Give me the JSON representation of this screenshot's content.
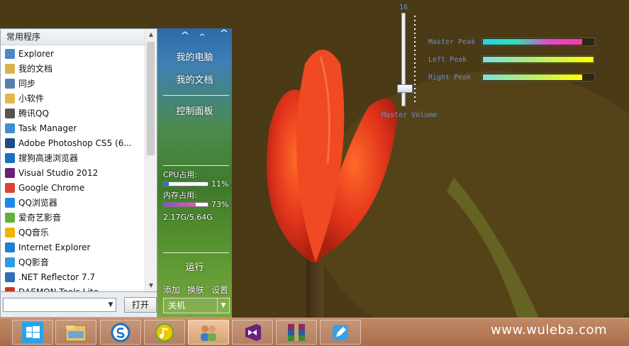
{
  "start_menu": {
    "list_header": "常用程序",
    "apps": [
      {
        "label": "Explorer",
        "icon": "explorer-icon",
        "color": "#4d87c7"
      },
      {
        "label": "我的文档",
        "icon": "documents-icon",
        "color": "#d9b24a"
      },
      {
        "label": "同步",
        "icon": "sync-icon",
        "color": "#5a7fb3"
      },
      {
        "label": "小软件",
        "icon": "folder-icon",
        "color": "#e3b64a"
      },
      {
        "label": "腾讯QQ",
        "icon": "qq-icon",
        "color": "#555555"
      },
      {
        "label": "Task Manager",
        "icon": "task-manager-icon",
        "color": "#3c8fd1"
      },
      {
        "label": "Adobe Photoshop CS5 (6...",
        "icon": "photoshop-icon",
        "color": "#1b4d8a"
      },
      {
        "label": "搜狗高速浏览器",
        "icon": "sogou-browser-icon",
        "color": "#1a6fc2"
      },
      {
        "label": "Visual Studio 2012",
        "icon": "visual-studio-icon",
        "color": "#68217a"
      },
      {
        "label": "Google Chrome",
        "icon": "chrome-icon",
        "color": "#db4437"
      },
      {
        "label": "QQ浏览器",
        "icon": "qq-browser-icon",
        "color": "#1e88e5"
      },
      {
        "label": "爱奇艺影音",
        "icon": "iqiyi-icon",
        "color": "#5fb236"
      },
      {
        "label": "QQ音乐",
        "icon": "qq-music-icon",
        "color": "#f0b400"
      },
      {
        "label": "Internet Explorer",
        "icon": "ie-icon",
        "color": "#1f7fd1"
      },
      {
        "label": "QQ影音",
        "icon": "qq-player-icon",
        "color": "#2b9de0"
      },
      {
        "label": ".NET Reflector 7.7",
        "icon": "reflector-icon",
        "color": "#2c6fb7"
      },
      {
        "label": "DAEMON Tools Lite",
        "icon": "daemon-tools-icon",
        "color": "#c0392b"
      }
    ],
    "run_placeholder": "",
    "open_button": "打开",
    "right_panel": {
      "my_computer": "我的电脑",
      "my_documents": "我的文档",
      "control_panel": "控制面板",
      "cpu_label": "CPU占用:",
      "cpu_percent": "11%",
      "cpu_fraction": 0.11,
      "mem_label": "内存占用:",
      "mem_percent": "73%",
      "mem_fraction": 0.73,
      "mem_size": "2.17G/5.64G",
      "run": "运行",
      "add": "添加",
      "skin": "换肤",
      "settings": "设置",
      "shutdown": "关机"
    }
  },
  "volume": {
    "level": "16",
    "label": "Master Volume",
    "master_peak": "Master Peak",
    "left_peak": "Left Peak",
    "right_peak": "Right Peak",
    "master_peak_level": 0.9,
    "left_peak_level": 1.0,
    "right_peak_level": 0.9
  },
  "taskbar": {
    "items": [
      {
        "name": "start-button",
        "icon": "windows-logo-icon",
        "active": false
      },
      {
        "name": "file-explorer-button",
        "icon": "file-explorer-icon",
        "active": false
      },
      {
        "name": "sogou-browser-button",
        "icon": "sogou-browser-icon",
        "active": false
      },
      {
        "name": "qq-music-button",
        "icon": "qq-music-icon",
        "active": false
      },
      {
        "name": "contacts-button",
        "icon": "contacts-icon",
        "active": true
      },
      {
        "name": "visual-studio-button",
        "icon": "visual-studio-icon",
        "active": false
      },
      {
        "name": "winrar-button",
        "icon": "winrar-icon",
        "active": false
      },
      {
        "name": "note-app-button",
        "icon": "note-icon",
        "active": false
      }
    ]
  },
  "watermark": "www.wuleba.com"
}
